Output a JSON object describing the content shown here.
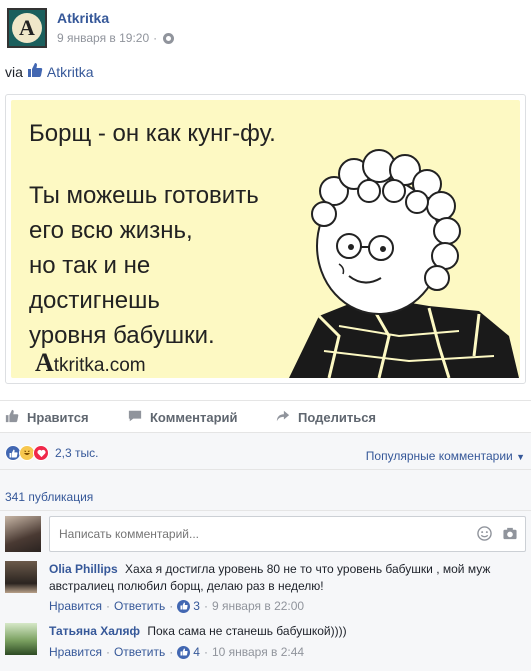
{
  "post": {
    "page_name": "Atkritka",
    "avatar_letter": "A",
    "date": "9 января в 19:20",
    "via_prefix": "via",
    "via_name": "Atkritka",
    "card": {
      "line1": "Борщ - он как кунг-фу.",
      "lines": [
        "Ты можешь готовить",
        "его всю жизнь,",
        "но так и не",
        "достигнешь",
        "уровня бабушки."
      ],
      "brand_big": "A",
      "brand_rest": "tkritka.com"
    }
  },
  "actions": {
    "like": "Нравится",
    "comment": "Комментарий",
    "share": "Поделиться"
  },
  "stats": {
    "reactions_count": "2,3 тыс.",
    "sort_label": "Популярные комментарии",
    "shares": "341 публикация"
  },
  "composer": {
    "placeholder": "Написать комментарий..."
  },
  "comments": [
    {
      "name": "Olia Phillips",
      "text": "Хаха я достигла уровень 80 не то что уровень бабушки , мой муж австралиец полюбил борщ, делаю раз в неделю!",
      "like_label": "Нравится",
      "reply_label": "Ответить",
      "likes": "3",
      "time": "9 января в 22:00"
    },
    {
      "name": "Татьяна Халяф",
      "text": "Пока сама не станешь бабушкой))))",
      "like_label": "Нравится",
      "reply_label": "Ответить",
      "likes": "4",
      "time": "10 января в 2:44"
    }
  ],
  "colors": {
    "link": "#365899",
    "card_bg": "#fdf9c3",
    "meta": "#90949c"
  }
}
